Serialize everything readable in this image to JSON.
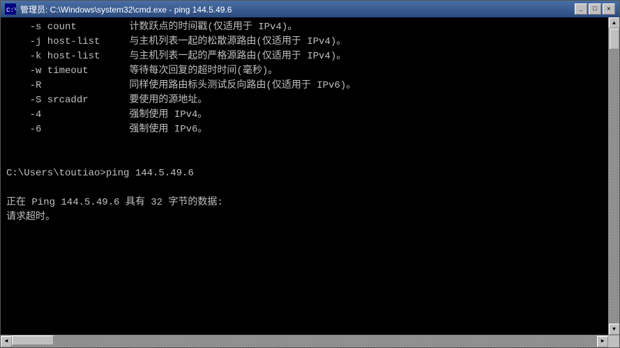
{
  "window": {
    "title": "管理员: C:\\Windows\\system32\\cmd.exe - ping  144.5.49.6",
    "icon": "cmd"
  },
  "controls": {
    "minimize": "_",
    "maximize": "□",
    "close": "✕"
  },
  "scrollbar": {
    "up_arrow": "▲",
    "down_arrow": "▼",
    "left_arrow": "◄",
    "right_arrow": "►"
  },
  "terminal": {
    "lines": [
      "    -s count         计数跃点的时间戳(仅适用于 IPv4)。",
      "    -j host-list     与主机列表一起的松散源路由(仅适用于 IPv4)。",
      "    -k host-list     与主机列表一起的严格源路由(仅适用于 IPv4)。",
      "    -w timeout       等待每次回复的超时时间(毫秒)。",
      "    -R               同样使用路由标头测试反向路由(仅适用于 IPv6)。",
      "    -S srcaddr       要使用的源地址。",
      "    -4               强制使用 IPv4。",
      "    -6               强制使用 IPv6。"
    ],
    "prompt_line": "C:\\Users\\toutiao>ping 144.5.49.6",
    "ping_start": "正在 Ping 144.5.49.6 具有 32 字节的数据:",
    "ping_result": "请求超时。",
    "cursor_line": ""
  }
}
